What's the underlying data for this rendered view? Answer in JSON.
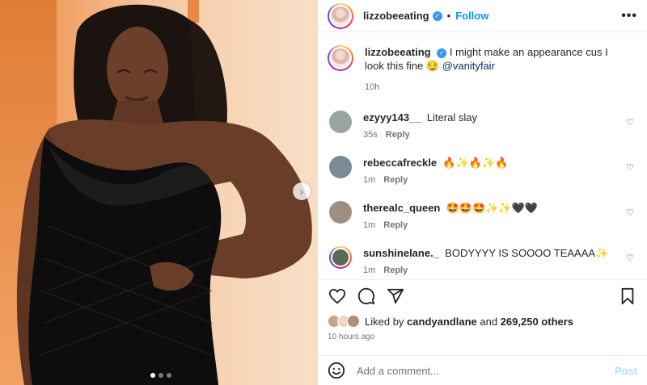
{
  "header": {
    "username": "lizzobeeating",
    "separator": "•",
    "follow_label": "Follow",
    "more_label": "•••"
  },
  "caption": {
    "username": "lizzobeeating",
    "text": "I might make an appearance cus I look this fine 😏",
    "mention": "@vanityfair",
    "time": "10h"
  },
  "comments": [
    {
      "username": "ezyyy143__",
      "text": "Literal slay",
      "time": "35s",
      "reply": "Reply",
      "avatar_color": "#9aa5a0"
    },
    {
      "username": "rebeccafreckle",
      "text": "🔥✨🔥✨🔥",
      "time": "1m",
      "reply": "Reply",
      "avatar_color": "#7c8a96"
    },
    {
      "username": "therealc_queen",
      "text": "🤩🤩🤩✨✨🖤🖤",
      "time": "1m",
      "reply": "Reply",
      "avatar_color": "#a08f80"
    },
    {
      "username": "sunshinelane._",
      "text": "BODYYYY IS SOOOO TEAAAA✨",
      "time": "1m",
      "reply": "Reply",
      "avatar_color": "#5a6a54"
    }
  ],
  "likes": {
    "prefix": "Liked by",
    "user": "candyandlane",
    "and": "and",
    "count": "269,250 others"
  },
  "timestamp": "10 hours ago",
  "add_comment": {
    "placeholder": "Add a comment...",
    "post_label": "Post"
  },
  "colors": {
    "accent": "#0095f6",
    "verified": "#3897f0",
    "post_disabled": "#b2dffc"
  },
  "icons": [
    "chevron-right-icon",
    "more-icon",
    "heart-icon",
    "comment-icon",
    "share-icon",
    "bookmark-icon",
    "emoji-icon",
    "verified-icon"
  ]
}
